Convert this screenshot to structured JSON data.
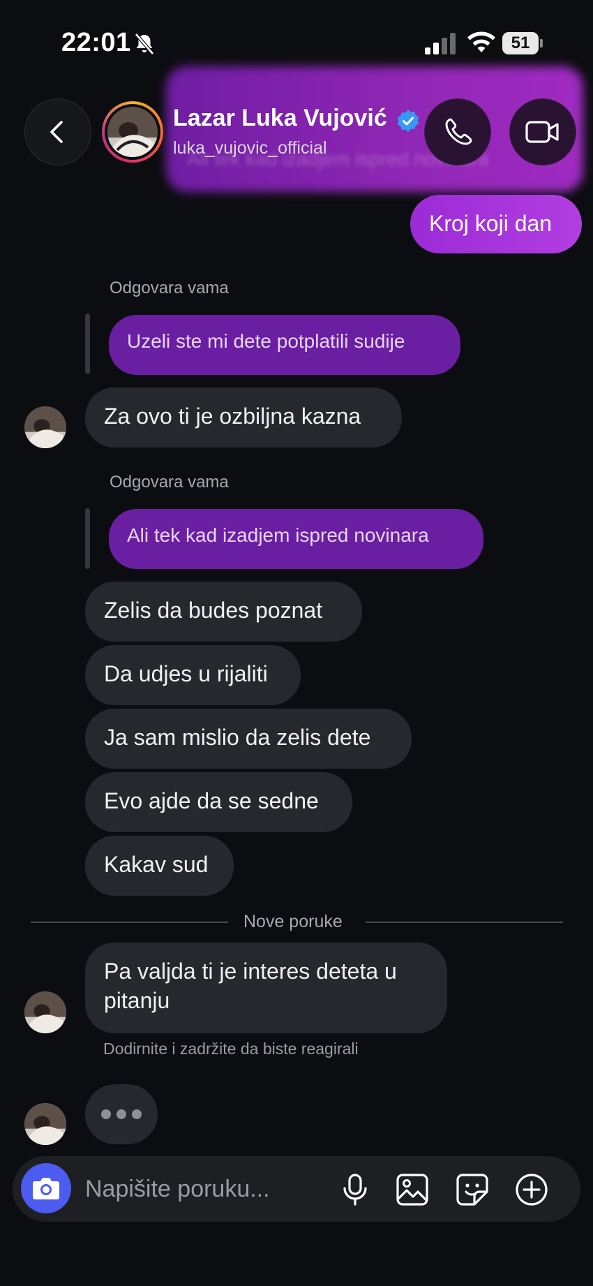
{
  "status_bar": {
    "time": "22:01",
    "battery": "51"
  },
  "header": {
    "name": "Lazar Luka Vujović",
    "username": "luka_vujovic_official",
    "previous_message_blurred": "Ali tek kad izadjem ispred novinara"
  },
  "messages": {
    "outgoing_1": "Kroj koji dan",
    "reply_label": "Odgovara vama",
    "quoted_1": "Uzeli ste mi dete potplatili sudije",
    "incoming_1": "Za ovo ti je ozbiljna kazna",
    "quoted_2": "Ali tek kad izadjem ispred novinara",
    "incoming_2": "Zelis da budes poznat",
    "incoming_3": "Da udjes u rijaliti",
    "incoming_4": "Ja sam mislio da zelis dete",
    "incoming_5": "Evo ajde da se sedne",
    "incoming_6": "Kakav sud",
    "new_messages_divider": "Nove poruke",
    "incoming_7_line1": "Pa valjda ti je interes deteta u",
    "incoming_7_line2": "pitanju",
    "react_hint": "Dodirnite i zadržite da biste reagirali"
  },
  "composer": {
    "placeholder": "Napišite poruku..."
  },
  "colors": {
    "background": "#0c0d10",
    "incoming_bubble": "#26282d",
    "outgoing_bubble": "#a534da",
    "quoted_bubble": "#6a1ea2",
    "camera_button": "#4c5bf0",
    "verified_badge": "#3897f0"
  },
  "icons": {
    "back": "chevron-left-icon",
    "call": "phone-icon",
    "video": "video-camera-icon",
    "camera": "camera-icon",
    "mic": "microphone-icon",
    "gallery": "image-icon",
    "sticker": "sticker-icon",
    "more": "plus-circle-icon"
  }
}
